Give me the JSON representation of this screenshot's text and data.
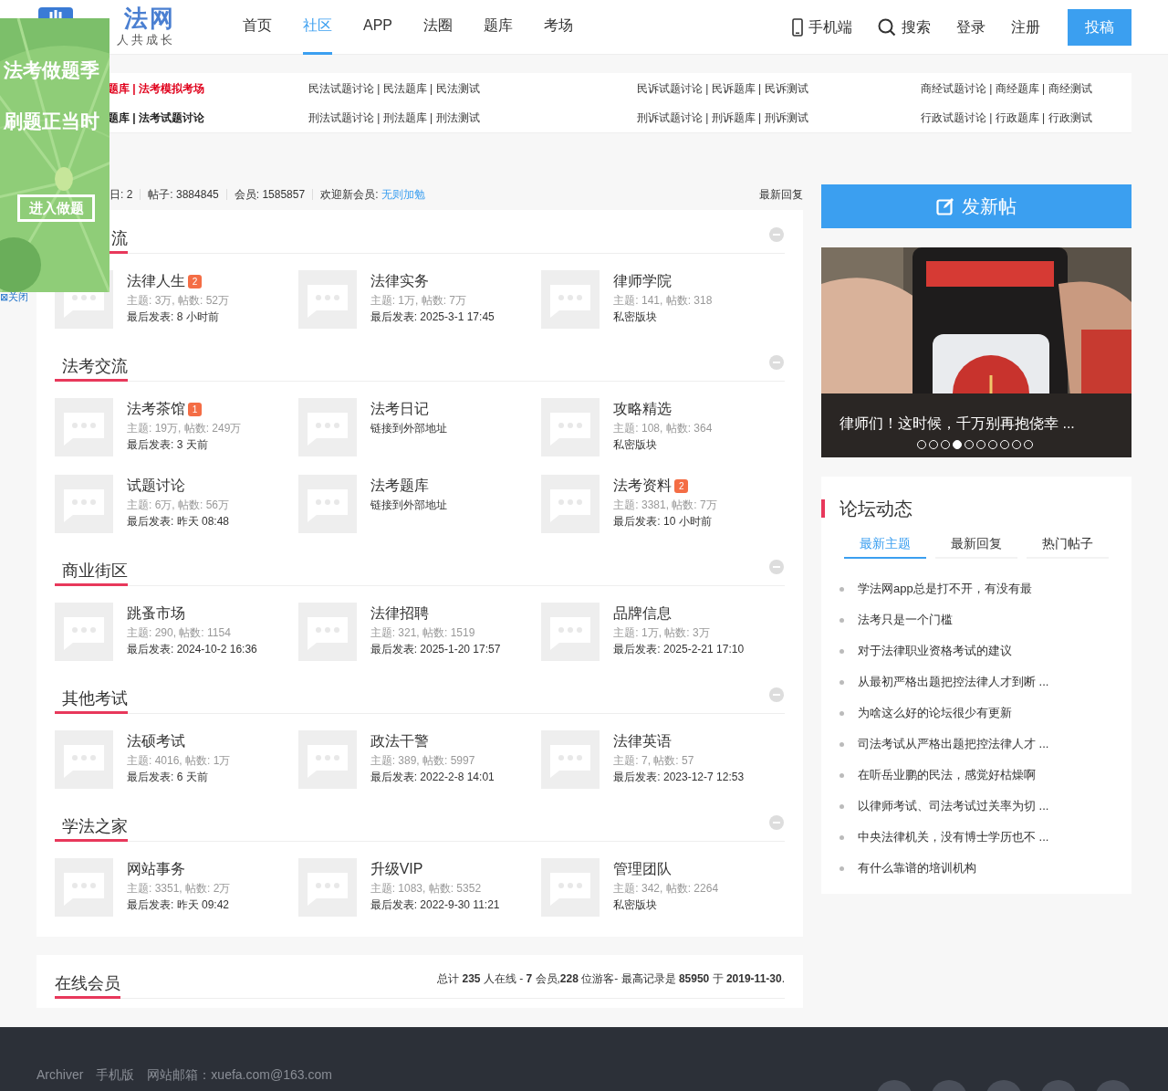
{
  "header": {
    "logo": {
      "name": "法网",
      "tagline": "人共成长"
    },
    "nav": [
      {
        "label": "首页",
        "selected": false
      },
      {
        "label": "社区",
        "selected": true
      },
      {
        "label": "APP",
        "selected": false
      },
      {
        "label": "法圈",
        "selected": false
      },
      {
        "label": "题库",
        "selected": false
      },
      {
        "label": "考场",
        "selected": false
      }
    ],
    "actions": [
      {
        "kind": "mobile",
        "label": "手机端"
      },
      {
        "kind": "search",
        "label": "搜索"
      },
      {
        "kind": "plain",
        "label": "登录"
      },
      {
        "kind": "plain",
        "label": "注册"
      },
      {
        "kind": "primary",
        "label": "投稿"
      }
    ]
  },
  "quick_links": [
    [
      {
        "text": "题库 | 法考模拟考场",
        "kind": "highlight"
      },
      {
        "text": "民法试题讨论 | 民法题库 | 民法测试",
        "kind": "normal"
      },
      {
        "text": "民诉试题讨论 | 民诉题库 | 民诉测试",
        "kind": "normal"
      },
      {
        "text": "商经试题讨论 | 商经题库 | 商经测试",
        "kind": "normal"
      }
    ],
    [
      {
        "text": "题库 | 法考试题讨论",
        "kind": "bold"
      },
      {
        "text": "刑法试题讨论 | 刑法题库 | 刑法测试",
        "kind": "normal"
      },
      {
        "text": "刑诉试题讨论 | 刑诉题库 | 刑诉测试",
        "kind": "normal"
      },
      {
        "text": "行政试题讨论 | 行政题库 | 行政测试",
        "kind": "normal"
      }
    ]
  ],
  "stats": {
    "items": [
      "日: 2",
      "帖子: 3884845",
      "会员: 1585857"
    ],
    "welcome": "欢迎新会员: ",
    "new_member": "无则加勉",
    "latest_reply": "最新回复"
  },
  "sections": [
    {
      "title": "流",
      "forums": [
        {
          "name": "法律人生",
          "badge": "2",
          "stats": "主题: 3万, 帖数: 52万",
          "last": "最后发表: 8 小时前"
        },
        {
          "name": "法律实务",
          "stats": "主题: 1万, 帖数: 7万",
          "last": "最后发表: 2025-3-1 17:45"
        },
        {
          "name": "律师学院",
          "stats": "主题: 141, 帖数: 318",
          "last": "私密版块"
        }
      ]
    },
    {
      "title": "法考交流",
      "forums": [
        {
          "name": "法考茶馆",
          "badge": "1",
          "stats": "主题: 19万, 帖数: 249万",
          "last": "最后发表: 3 天前"
        },
        {
          "name": "法考日记",
          "last": "链接到外部地址"
        },
        {
          "name": "攻略精选",
          "stats": "主题: 108, 帖数: 364",
          "last": "私密版块"
        },
        {
          "name": "试题讨论",
          "stats": "主题: 6万, 帖数: 56万",
          "last": "最后发表: 昨天 08:48"
        },
        {
          "name": "法考题库",
          "last": "链接到外部地址"
        },
        {
          "name": "法考资料",
          "badge": "2",
          "stats": "主题: 3381, 帖数: 7万",
          "last": "最后发表: 10 小时前"
        }
      ]
    },
    {
      "title": "商业街区",
      "forums": [
        {
          "name": "跳蚤市场",
          "stats": "主题: 290, 帖数: 1154",
          "last": "最后发表: 2024-10-2 16:36"
        },
        {
          "name": "法律招聘",
          "stats": "主题: 321, 帖数: 1519",
          "last": "最后发表: 2025-1-20 17:57"
        },
        {
          "name": "品牌信息",
          "stats": "主题: 1万, 帖数: 3万",
          "last": "最后发表: 2025-2-21 17:10"
        }
      ]
    },
    {
      "title": "其他考试",
      "forums": [
        {
          "name": "法硕考试",
          "stats": "主题: 4016, 帖数: 1万",
          "last": "最后发表: 6 天前"
        },
        {
          "name": "政法干警",
          "stats": "主题: 389, 帖数: 5997",
          "last": "最后发表: 2022-2-8 14:01"
        },
        {
          "name": "法律英语",
          "stats": "主题: 7, 帖数: 57",
          "last": "最后发表: 2023-12-7 12:53"
        }
      ]
    },
    {
      "title": "学法之家",
      "forums": [
        {
          "name": "网站事务",
          "stats": "主题: 3351, 帖数: 2万",
          "last": "最后发表: 昨天 09:42"
        },
        {
          "name": "升级VIP",
          "stats": "主题: 1083, 帖数: 5352",
          "last": "最后发表: 2022-9-30 11:21"
        },
        {
          "name": "管理团队",
          "stats": "主题: 342, 帖数: 2264",
          "last": "私密版块"
        }
      ]
    }
  ],
  "online": {
    "title": "在线会员",
    "summary": "总计 **235** 人在线 - **7** 会员,**228** 位游客- 最高记录是 **85950** 于 **2019-11-30**."
  },
  "sidebar": {
    "post_button": "发新帖",
    "carousel": {
      "caption": "律师们！这时候，千万别再抱侥幸 ...",
      "dots": [
        {
          "selected": false
        },
        {
          "selected": false
        },
        {
          "selected": false
        },
        {
          "selected": true
        },
        {
          "selected": false
        },
        {
          "selected": false
        },
        {
          "selected": false
        },
        {
          "selected": false
        },
        {
          "selected": false
        },
        {
          "selected": false
        }
      ]
    },
    "activity": {
      "title": "论坛动态",
      "tabs": [
        {
          "label": "最新主题",
          "selected": true
        },
        {
          "label": "最新回复",
          "selected": false
        },
        {
          "label": "热门帖子",
          "selected": false
        }
      ],
      "items": [
        "学法网app总是打不开，有没有最",
        "法考只是一个门槛",
        "对于法律职业资格考试的建议",
        "从最初严格出题把控法律人才到断 ...",
        "为啥这么好的论坛很少有更新",
        "司法考试从严格出题把控法律人才 ...",
        "在听岳业鹏的民法，感觉好枯燥啊",
        "以律师考试、司法考试过关率为切 ...",
        "中央法律机关，没有博士学历也不 ...",
        "有什么靠谱的培训机构"
      ]
    }
  },
  "footer": {
    "links": [
      "Archiver",
      "手机版",
      "网站邮箱：xuefa.com@163.com"
    ]
  },
  "ad": {
    "lines": [
      "法考做题季",
      "刷题正当时"
    ],
    "button": "进入做题",
    "close": "⊠关闭"
  }
}
